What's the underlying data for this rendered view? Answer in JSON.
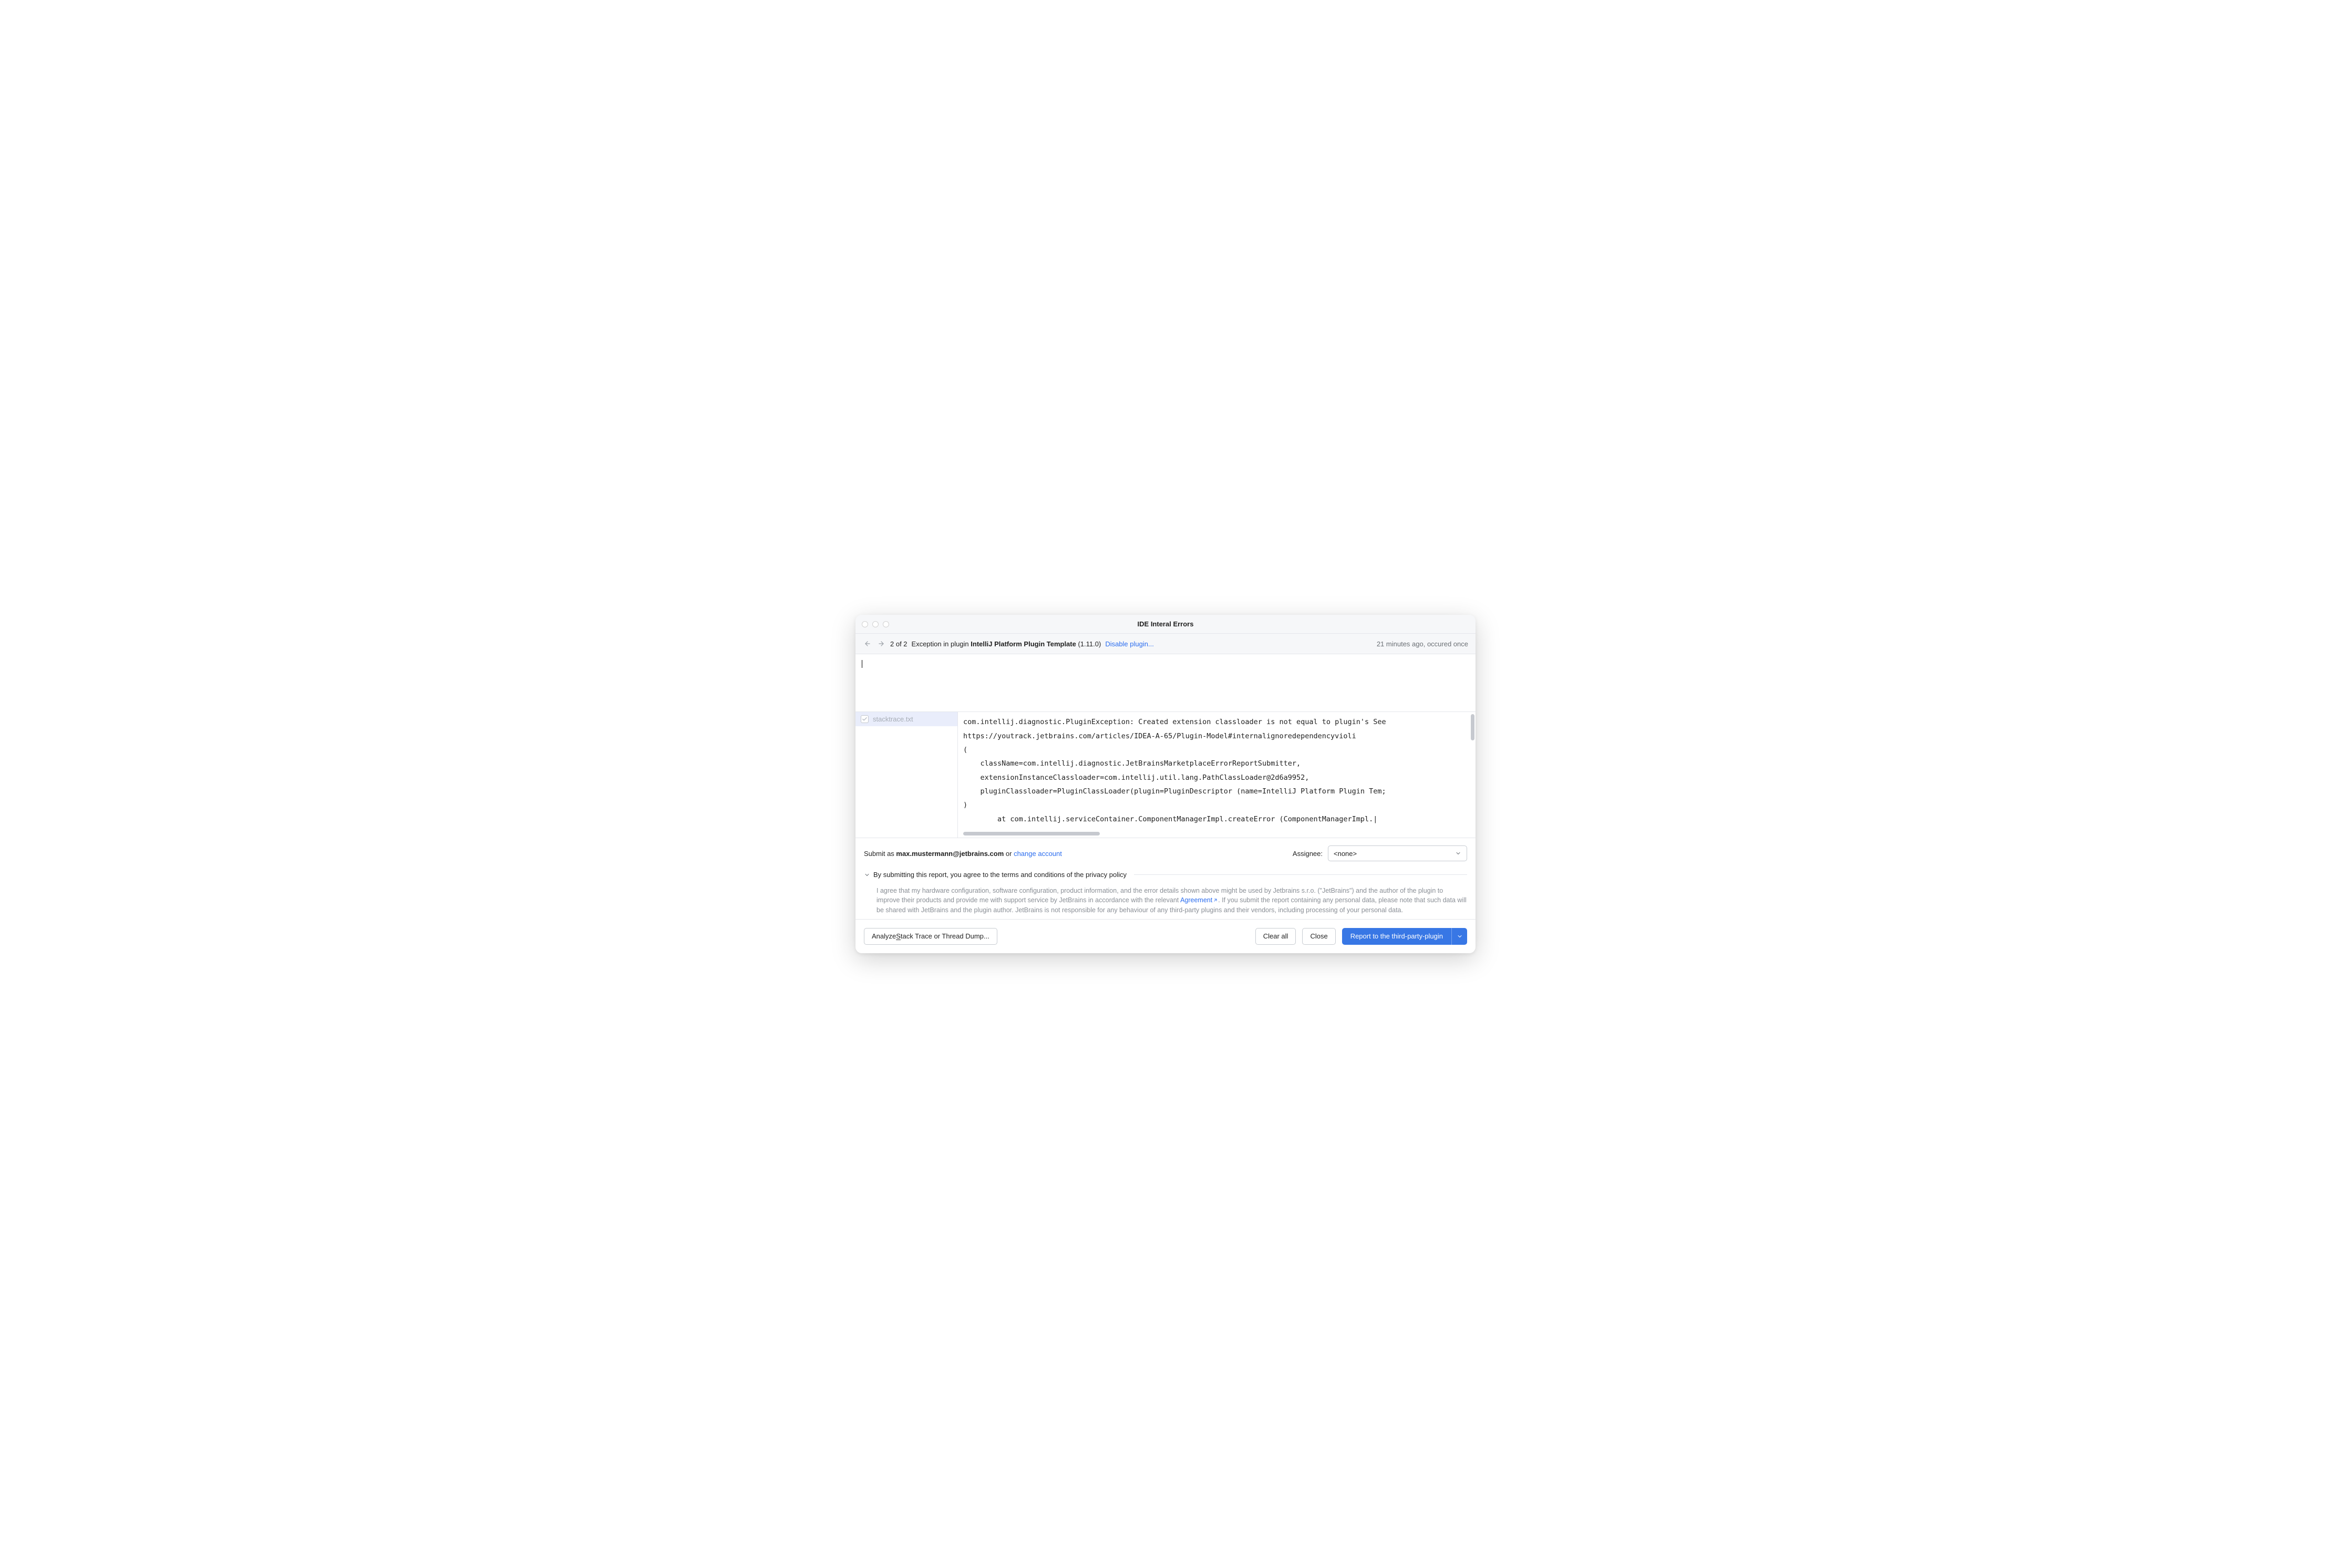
{
  "window": {
    "title": "IDE Interal Errors"
  },
  "nav": {
    "counter": "2 of 2",
    "prefix": "Exception in plugin ",
    "plugin_name": "IntelliJ Platform Plugin Template",
    "version_suffix": " (1.11.0)  ",
    "disable_link": "Disable plugin...",
    "timestamp": "21 minutes ago, occured once"
  },
  "attachments": {
    "items": [
      {
        "label": "stacktrace.txt",
        "checked": true
      }
    ]
  },
  "stacktrace": "com.intellij.diagnostic.PluginException: Created extension classloader is not equal to plugin's See\nhttps://youtrack.jetbrains.com/articles/IDEA-A-65/Plugin-Model#internalignoredependencyvioli\n(\n    className=com.intellij.diagnostic.JetBrainsMarketplaceErrorReportSubmitter,\n    extensionInstanceClassloader=com.intellij.util.lang.PathClassLoader@2d6a9952,\n    pluginClassloader=PluginClassLoader(plugin=PluginDescriptor (name=IntelliJ Platform Plugin Tem;\n)\n        at com.intellij.serviceContainer.ComponentManagerImpl.createError (ComponentManagerImpl.|",
  "submit": {
    "prefix": "Submit as ",
    "email": "max.mustermann@jetbrains.com",
    "or": " or ",
    "change_link": "change account"
  },
  "assignee": {
    "label": "Assignee:",
    "value": "<none>"
  },
  "disclosure": {
    "heading": "By submitting this report, you agree to the terms and conditions of the privacy policy",
    "legal_before": "I agree that my hardware configuration, software configuration, product information, and the error details shown above might be used by Jetbrains s.r.o. (\"JetBrains\") and the author of the plugin to improve their products and provide me with support service by JetBrains in accordance with the relevant ",
    "legal_link": "Agreement",
    "legal_after": ". If you submit the report containing any personal data, please note that such data will be shared with JetBrains and the plugin author. JetBrains is not responsible for any behaviour of any third-party plugins and their vendors, including processing of your personal data."
  },
  "footer": {
    "analyze_before": "Analyze ",
    "analyze_under": "S",
    "analyze_after": "tack Trace or Thread Dump...",
    "clear": "Clear all",
    "close": "Close",
    "report": "Report to the third-party-plugin"
  }
}
